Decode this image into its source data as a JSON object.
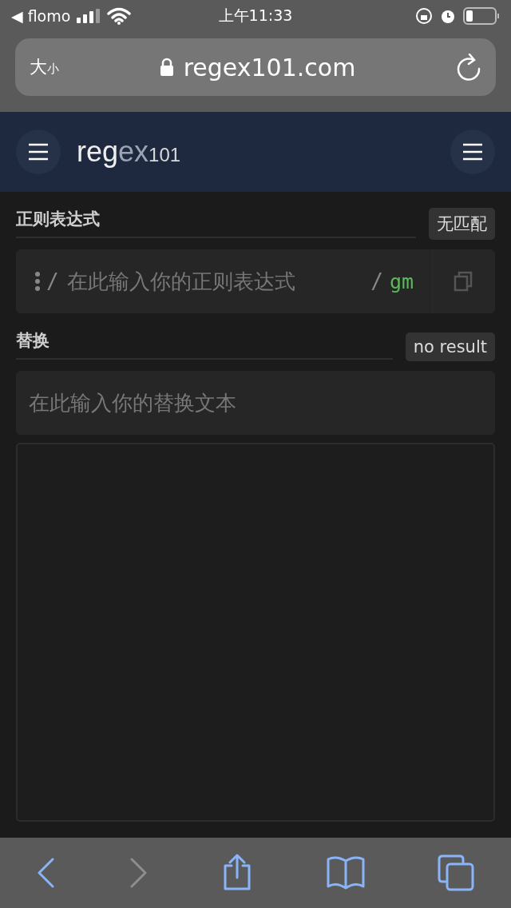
{
  "status_bar": {
    "back_app": "◀ flomo",
    "time": "上午11:33"
  },
  "address_bar": {
    "text_size": [
      "大",
      "小"
    ],
    "url": "regex101.com"
  },
  "header": {
    "logo": [
      {
        "kind": "main",
        "text": "reg"
      },
      {
        "kind": "dim",
        "text": "ex"
      },
      {
        "kind": "small",
        "text": "101"
      }
    ]
  },
  "regex": {
    "label": "正则表达式",
    "badge": "无匹配",
    "delimiter_open": "/",
    "placeholder": "在此输入你的正则表达式",
    "delimiter_close": "/",
    "flags": "gm"
  },
  "substitution": {
    "label": "替换",
    "badge": "no result",
    "placeholder": "在此输入你的替换文本"
  },
  "toolbar": [
    {
      "kind": "back",
      "disabled": false
    },
    {
      "kind": "forward",
      "disabled": true
    },
    {
      "kind": "share",
      "disabled": false
    },
    {
      "kind": "bookmarks",
      "disabled": false
    },
    {
      "kind": "tabs",
      "disabled": false
    }
  ]
}
